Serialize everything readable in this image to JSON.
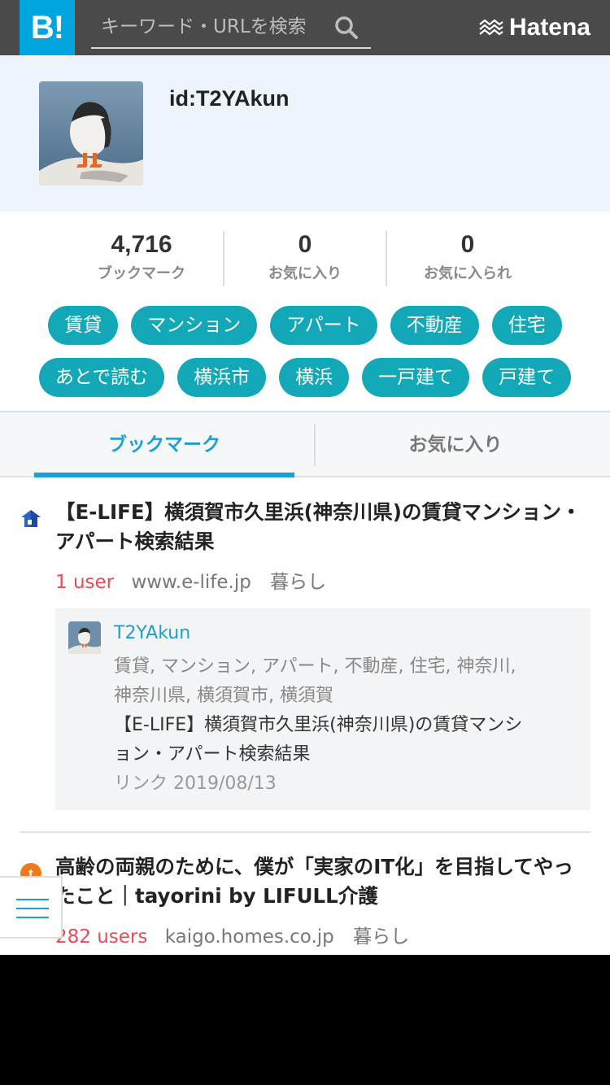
{
  "header": {
    "logo_text": "B!",
    "search_placeholder": "キーワード・URLを検索",
    "brand": "Hatena"
  },
  "profile": {
    "user_id": "id:T2YAkun"
  },
  "stats": [
    {
      "value": "4,716",
      "label": "ブックマーク"
    },
    {
      "value": "0",
      "label": "お気に入り"
    },
    {
      "value": "0",
      "label": "お気に入られ"
    }
  ],
  "tags": {
    "row1": [
      "賃貸",
      "マンション",
      "アパート",
      "不動産",
      "住宅"
    ],
    "row2": [
      "あとで読む",
      "横浜市",
      "横浜",
      "一戸建て",
      "戸建て"
    ]
  },
  "tabs": {
    "bookmarks": "ブックマーク",
    "favorites": "お気に入り"
  },
  "entries": [
    {
      "title": "【E-LIFE】横須賀市久里浜(神奈川県)の賃貸マンション・アパート検索結果",
      "users": "1 user",
      "domain": "www.e-life.jp",
      "category": "暮らし",
      "comment": {
        "user": "T2YAkun",
        "tags": "賃貸, マンション, アパート, 不動産, 住宅, 神奈川, 神奈川県, 横須賀市, 横須賀",
        "title": "【E-LIFE】横須賀市久里浜(神奈川県)の賃貸マンション・アパート検索結果",
        "date": "リンク 2019/08/13"
      }
    },
    {
      "title": "高齢の両親のために、僕が「実家のIT化」を目指してやったこと｜tayorini by LIFULL介護",
      "users": "282 users",
      "domain": "kaigo.homes.co.jp",
      "category": "暮らし"
    }
  ],
  "colors": {
    "header_bg": "#4a4a4a",
    "logo_bg": "#00a4de",
    "tag_bg": "#12a8b8",
    "accent": "#1c9fd1",
    "users_red": "#ec4a55"
  }
}
